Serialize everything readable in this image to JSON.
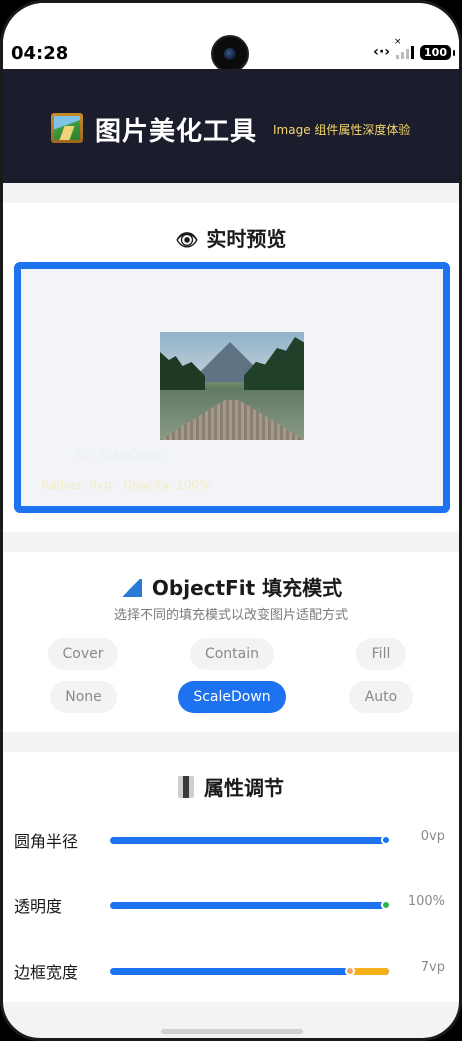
{
  "status_bar": {
    "time": "04:28",
    "battery": "100"
  },
  "header": {
    "title": "图片美化工具",
    "subtitle": "Image 组件属性深度体验"
  },
  "preview": {
    "title": "实时预览",
    "title_icon": "eye-icon",
    "fit_label": "Fit: ScaleDown",
    "info_label": "Radius: 0vp  ·  Opacity: 100%"
  },
  "object_fit": {
    "title": "ObjectFit 填充模式",
    "title_icon": "triangle-ruler-icon",
    "description": "选择不同的填充模式以改变图片适配方式",
    "options": [
      {
        "label": "Cover",
        "selected": false
      },
      {
        "label": "Contain",
        "selected": false
      },
      {
        "label": "Fill",
        "selected": false
      },
      {
        "label": "None",
        "selected": false
      },
      {
        "label": "ScaleDown",
        "selected": true
      },
      {
        "label": "Auto",
        "selected": false
      }
    ]
  },
  "properties": {
    "title": "属性调节",
    "title_icon": "adjust-icon",
    "items": [
      {
        "label": "圆角半径",
        "value": "0vp",
        "fraction": 1.0,
        "knob_color": "#1d72f0"
      },
      {
        "label": "透明度",
        "value": "100%",
        "fraction": 1.0,
        "knob_color": "#2fb34a"
      },
      {
        "label": "边框宽度",
        "value": "7vp",
        "fraction": 0.87,
        "knob_color": "#f5a26a"
      }
    ]
  },
  "colors": {
    "accent": "#1d72f0",
    "header_bg": "#1b1d2d",
    "subtitle": "#f5d86a",
    "slider_rest": "#f5b01a"
  }
}
